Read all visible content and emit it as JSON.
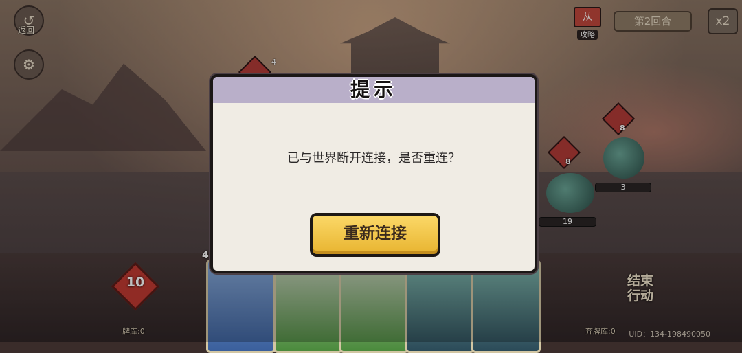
{
  "top_bar": {
    "back_label": "返回",
    "strategy_label": "攻略",
    "strategy_badge": "从",
    "round_label": "第2回合",
    "speed_label": "x2"
  },
  "battle": {
    "enemy_atk": [
      "8",
      "8"
    ],
    "enemy_small_num": "4",
    "enemy_hp": [
      "3",
      "19"
    ],
    "energy": "10",
    "card_cost": "4",
    "draw_pile_label": "牌库:0",
    "discard_pile_label": "弃牌库:0",
    "end_turn_label": "结束\n行动"
  },
  "modal": {
    "title": "提示",
    "message": "已与世界断开连接，是否重连？",
    "reconnect_button": "重新连接"
  },
  "footer": {
    "uid": "UID：134-198490050"
  },
  "icons": [
    "back-icon",
    "settings-gear-icon",
    "strategy-book-icon",
    "sword-icon"
  ]
}
